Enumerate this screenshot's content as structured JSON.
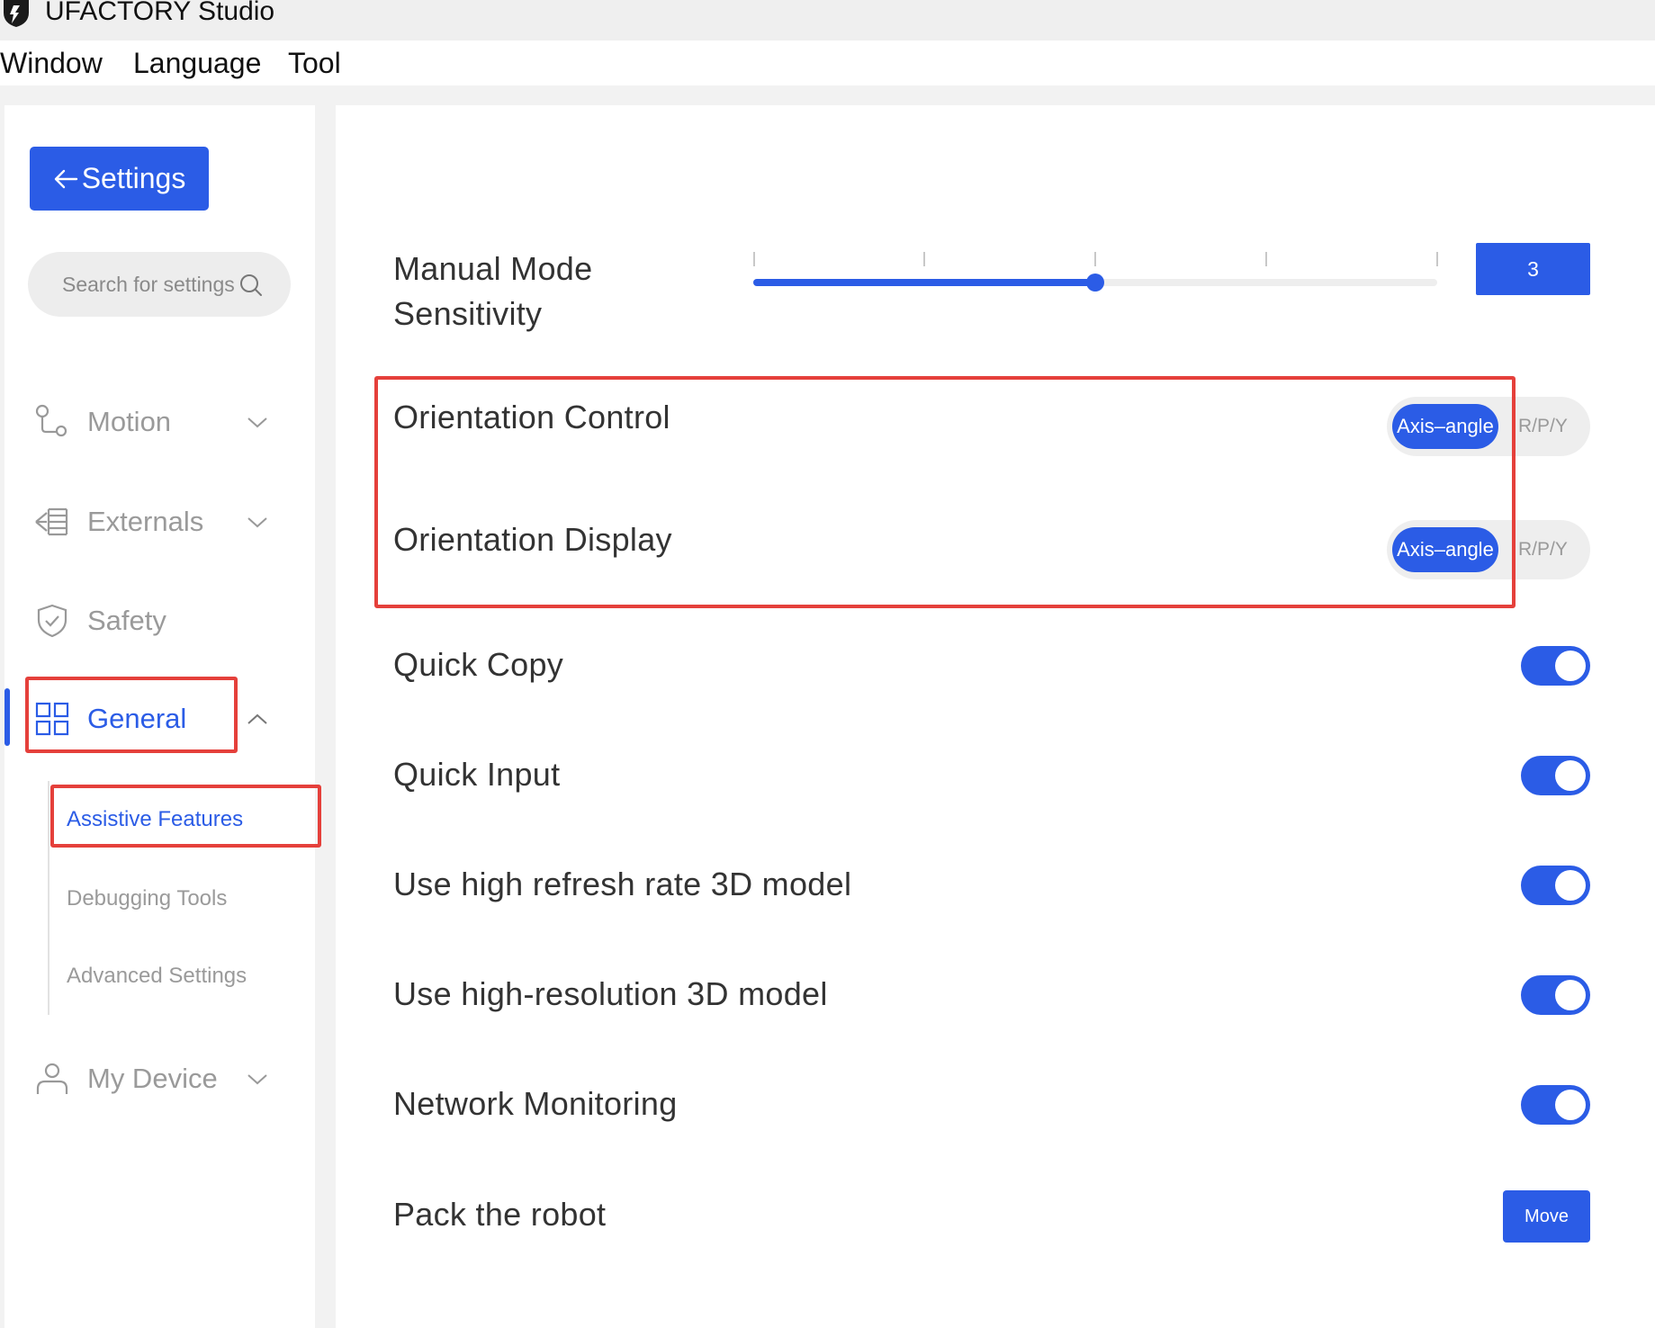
{
  "app": {
    "title": "UFACTORY Studio"
  },
  "menu": {
    "items": [
      "Window",
      "Language",
      "Tool"
    ]
  },
  "sidebar": {
    "back_label": "Settings",
    "search_placeholder": "Search for settings",
    "items": [
      {
        "label": "Motion",
        "icon": "motion-icon",
        "expanded": false
      },
      {
        "label": "Externals",
        "icon": "externals-icon",
        "expanded": false
      },
      {
        "label": "Safety",
        "icon": "shield-icon",
        "expanded": null
      },
      {
        "label": "General",
        "icon": "grid-icon",
        "expanded": true,
        "active": true
      },
      {
        "label": "My Device",
        "icon": "user-icon",
        "expanded": false
      }
    ],
    "subitems": [
      {
        "label": "Assistive Features",
        "active": true
      },
      {
        "label": "Debugging Tools",
        "active": false
      },
      {
        "label": "Advanced Settings",
        "active": false
      }
    ]
  },
  "settings": {
    "sensitivity": {
      "label_line1": "Manual Mode",
      "label_line2": "Sensitivity",
      "value": "3",
      "min": 1,
      "max": 5,
      "steps": 5
    },
    "orientation_control": {
      "label": "Orientation Control",
      "option_on": "Axis–angle",
      "option_off": "R/P/Y",
      "selected": "Axis–angle"
    },
    "orientation_display": {
      "label": "Orientation Display",
      "option_on": "Axis–angle",
      "option_off": "R/P/Y",
      "selected": "Axis–angle"
    },
    "quick_copy": {
      "label": "Quick Copy",
      "enabled": true
    },
    "quick_input": {
      "label": "Quick Input",
      "enabled": true
    },
    "high_refresh": {
      "label": "Use high refresh rate 3D model",
      "enabled": true
    },
    "high_res": {
      "label": "Use high-resolution 3D model",
      "enabled": true
    },
    "network_monitoring": {
      "label": "Network Monitoring",
      "enabled": true
    },
    "pack_robot": {
      "label": "Pack the robot",
      "button": "Move"
    }
  },
  "colors": {
    "accent": "#2b5ce6",
    "highlight": "#e5403b",
    "muted": "#9a9a9a"
  }
}
